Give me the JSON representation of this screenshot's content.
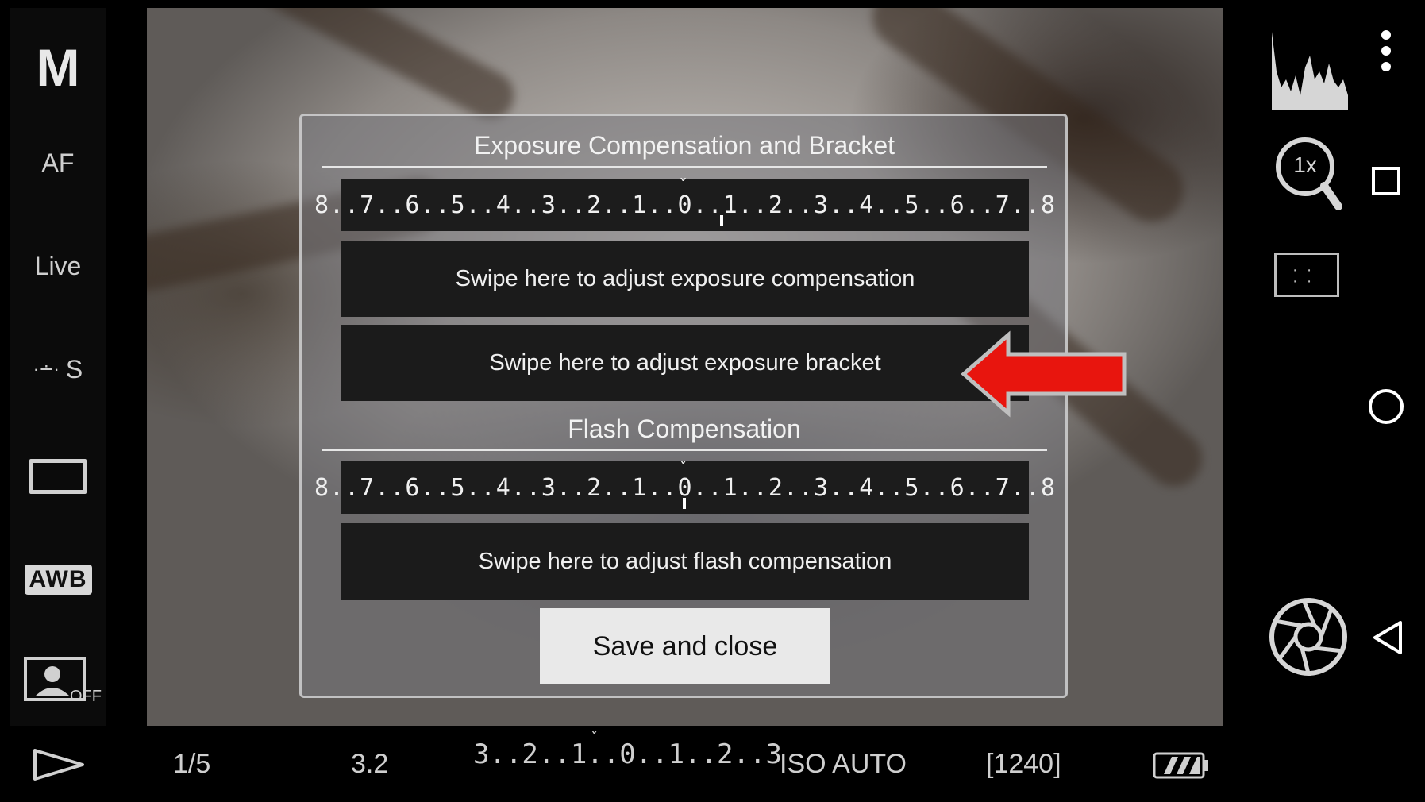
{
  "left_rail": {
    "mode": "M",
    "af": "AF",
    "live": "Live",
    "drive_letter": "S",
    "awb": "AWB",
    "face_detect_state": "OFF"
  },
  "dialog": {
    "exposure_title": "Exposure Compensation and Bracket",
    "exposure_scale": "8..7..6..5..4..3..2..1..0..1..2..3..4..5..6..7..8",
    "exposure_comp_swipe": "Swipe here to adjust exposure compensation",
    "exposure_bracket_swipe": "Swipe here to adjust exposure bracket",
    "flash_title": "Flash Compensation",
    "flash_scale": "8..7..6..5..4..3..2..1..0..1..2..3..4..5..6..7..8",
    "flash_swipe": "Swipe here to adjust flash compensation",
    "save_label": "Save and close"
  },
  "right_col": {
    "zoom": "1x"
  },
  "bottom_bar": {
    "shutter": "1/5",
    "aperture": "3.2",
    "ev_scale": "3..2..1..0..1..2..3",
    "iso": "ISO AUTO",
    "shots_remaining": "[1240]"
  },
  "icons": {
    "histogram": "histogram-icon",
    "zoom": "zoom-magnifier-icon",
    "focus_area": "focus-area-icon",
    "shutter": "aperture-shutter-icon",
    "settings": "gear-icon",
    "play": "play-icon",
    "battery": "battery-icon",
    "more": "more-vertical-icon",
    "recents": "recents-square-icon",
    "home": "home-circle-icon",
    "back": "back-triangle-icon",
    "annotation_arrow": "red-arrow-icon"
  },
  "colors": {
    "annotation_arrow": "#e8150e",
    "dialog_border": "#d7d7d7",
    "button_bg": "#e9e9e9"
  }
}
